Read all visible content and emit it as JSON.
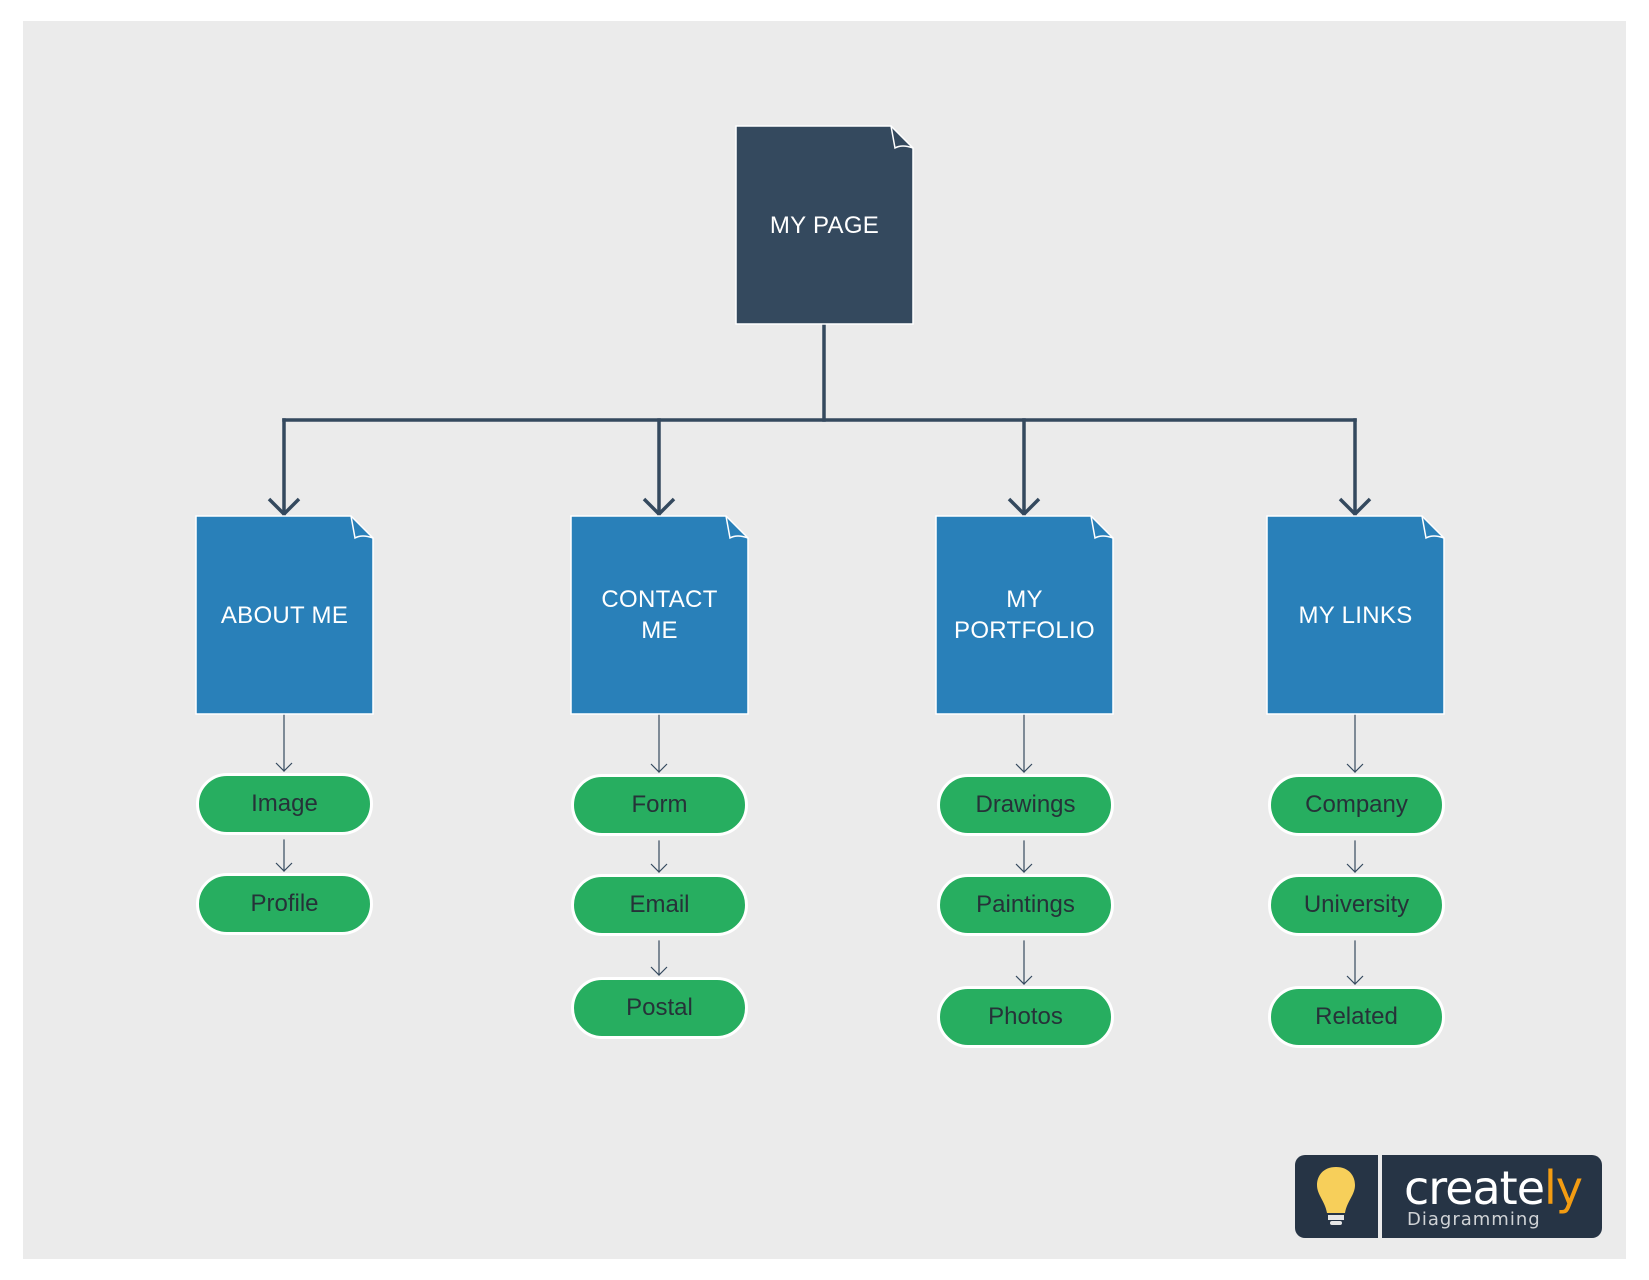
{
  "diagram": {
    "type": "sitemap",
    "root": {
      "label": "MY PAGE"
    },
    "sections": [
      {
        "label": "ABOUT ME",
        "items": [
          "Image",
          "Profile"
        ]
      },
      {
        "label": "CONTACT\nME",
        "items": [
          "Form",
          "Email",
          "Postal"
        ]
      },
      {
        "label": "MY\nPORTFOLIO",
        "items": [
          "Drawings",
          "Paintings",
          "Photos"
        ]
      },
      {
        "label": "MY LINKS",
        "items": [
          "Company",
          "University",
          "Related"
        ]
      }
    ]
  },
  "colors": {
    "root_fill": "#34495e",
    "section_fill": "#2980b9",
    "item_fill": "#27ae60",
    "connector": "#34495e",
    "canvas": "#ebebeb"
  },
  "watermark": {
    "brand_main": "create",
    "brand_accent": "ly",
    "tagline": "Diagramming",
    "icon": "lightbulb-icon"
  }
}
